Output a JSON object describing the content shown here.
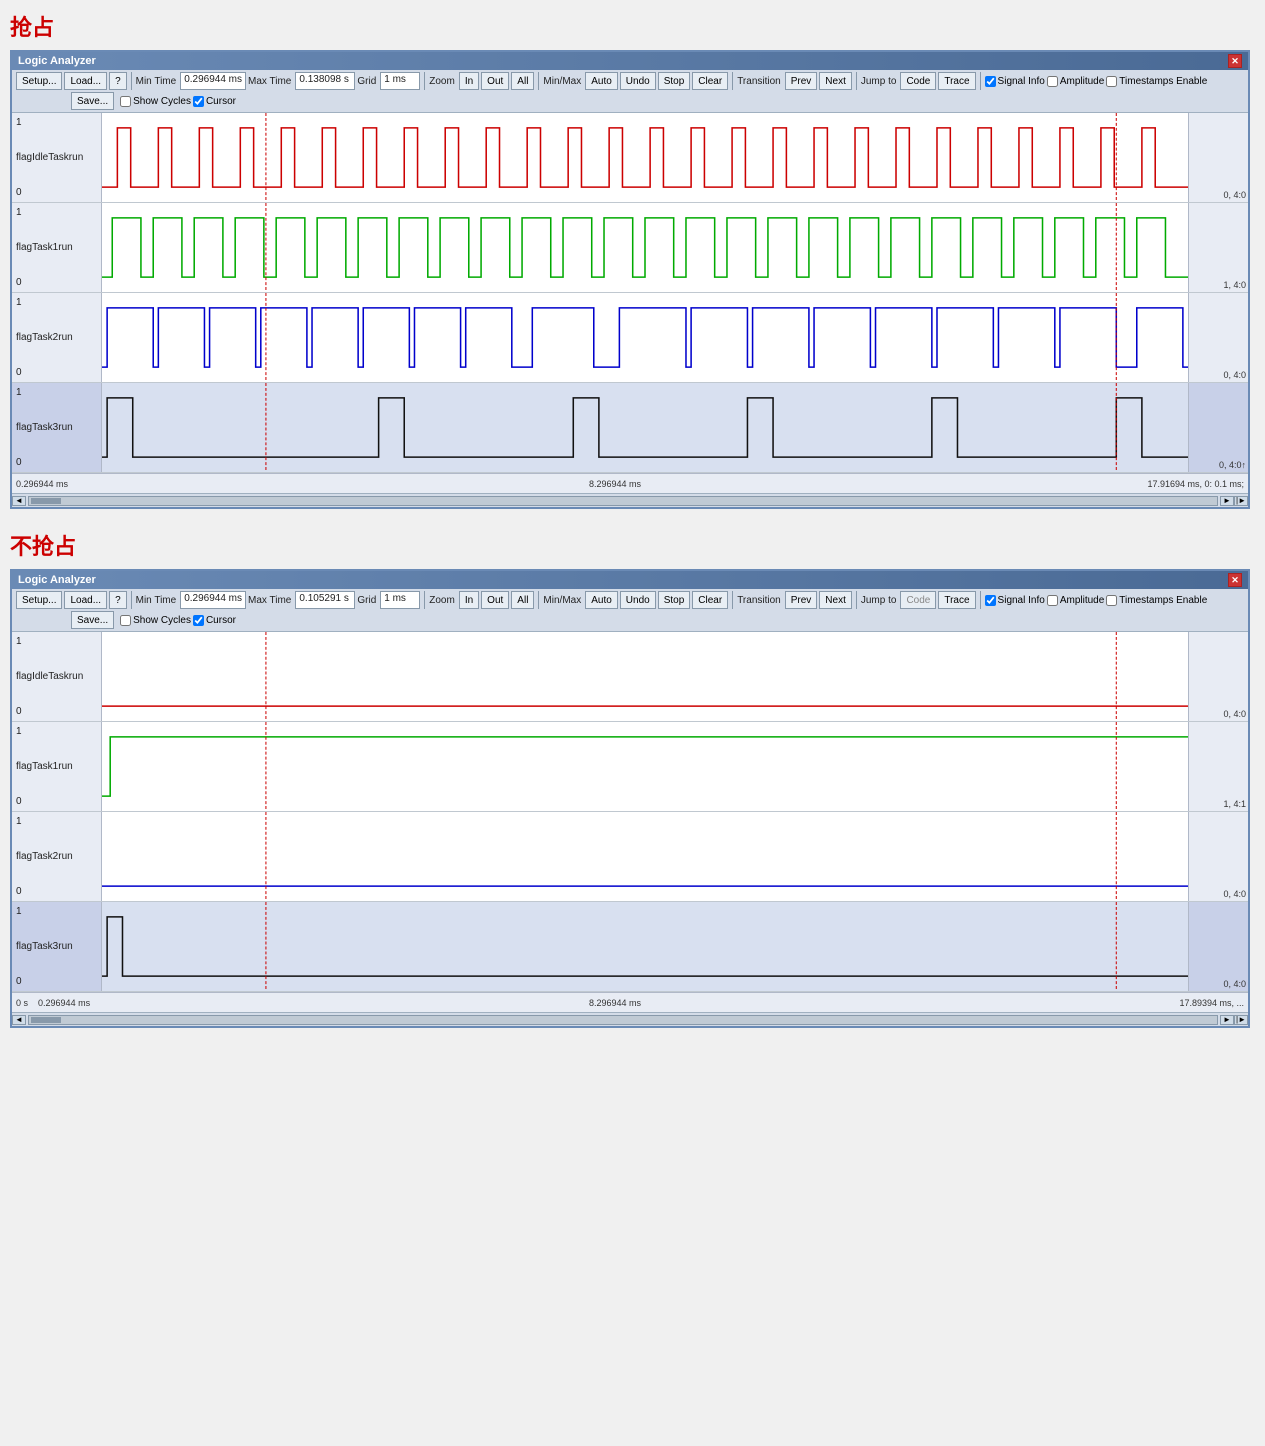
{
  "section1": {
    "title": "抢占",
    "analyzer_title": "Logic Analyzer",
    "toolbar": {
      "setup": "Setup...",
      "load": "Load...",
      "save": "Save...",
      "question": "?",
      "min_time_label": "Min Time",
      "min_time_val": "0.296944 ms",
      "max_time_label": "Max Time",
      "max_time_val": "0.138098 s",
      "grid_label": "Grid",
      "grid_val": "1 ms",
      "zoom_label": "Zoom",
      "zoom_in": "In",
      "zoom_out": "Out",
      "zoom_all": "All",
      "minmax_label": "Min/Max",
      "update_auto": "Auto",
      "update_undo": "Undo",
      "update_stop": "Stop",
      "update_clear": "Clear",
      "transition_label": "Transition",
      "trans_prev": "Prev",
      "trans_next": "Next",
      "jumpto_label": "Jump to",
      "jump_code": "Code",
      "jump_trace": "Trace",
      "signal_info": "Signal Info",
      "show_cycles": "Show Cycles",
      "amplitude": "Amplitude",
      "cursor": "Cursor",
      "timestamps": "Timestamps Enable"
    },
    "signals": [
      {
        "name": "flagIdleTaskrun",
        "color": "#cc0000",
        "top": "1",
        "bot": "0",
        "end_label": "0, 4:0",
        "highlighted": false
      },
      {
        "name": "flagTask1run",
        "color": "#00aa00",
        "top": "1",
        "bot": "0",
        "end_label": "1, 4:0",
        "highlighted": false
      },
      {
        "name": "flagTask2run",
        "color": "#0000cc",
        "top": "1",
        "bot": "0",
        "end_label": "0, 4:0",
        "highlighted": false
      },
      {
        "name": "flagTask3run",
        "color": "#111111",
        "top": "1",
        "bot": "0",
        "end_label": "0, 4:0↑",
        "highlighted": true
      }
    ],
    "timeline": {
      "start": "0.296944 ms",
      "mid": "8.296944 ms",
      "end": "17.91694 ms,  0: 0.1 ms;"
    }
  },
  "section2": {
    "title": "不抢占",
    "analyzer_title": "Logic Analyzer",
    "toolbar": {
      "setup": "Setup...",
      "load": "Load...",
      "save": "Save...",
      "question": "?",
      "min_time_label": "Min Time",
      "min_time_val": "0.296944 ms",
      "max_time_label": "Max Time",
      "max_time_val": "0.105291 s",
      "grid_label": "Grid",
      "grid_val": "1 ms",
      "zoom_label": "Zoom",
      "zoom_in": "In",
      "zoom_out": "Out",
      "zoom_all": "All",
      "minmax_label": "Min/Max",
      "update_auto": "Auto",
      "update_undo": "Undo",
      "update_stop": "Stop",
      "update_clear": "Clear",
      "transition_label": "Transition",
      "trans_prev": "Prev",
      "trans_next": "Next",
      "jumpto_label": "Jump to",
      "jump_code": "Code",
      "jump_trace": "Trace",
      "signal_info": "Signal Info",
      "show_cycles": "Show Cycles",
      "amplitude": "Amplitude",
      "cursor": "Cursor",
      "timestamps": "Timestamps Enable"
    },
    "signals": [
      {
        "name": "flagIdleTaskrun",
        "color": "#cc0000",
        "top": "1",
        "bot": "0",
        "end_label": "0, 4:0",
        "highlighted": false
      },
      {
        "name": "flagTask1run",
        "color": "#00aa00",
        "top": "1",
        "bot": "0",
        "end_label": "1, 4:1",
        "highlighted": false
      },
      {
        "name": "flagTask2run",
        "color": "#0000cc",
        "top": "1",
        "bot": "0",
        "end_label": "0, 4:0",
        "highlighted": false
      },
      {
        "name": "flagTask3run",
        "color": "#111111",
        "top": "1",
        "bot": "0",
        "end_label": "0, 4:0",
        "highlighted": true
      }
    ],
    "timeline": {
      "start": "0 s",
      "start2": "0.296944 ms",
      "mid": "8.296944 ms",
      "end": "17.89394 ms, ..."
    }
  }
}
